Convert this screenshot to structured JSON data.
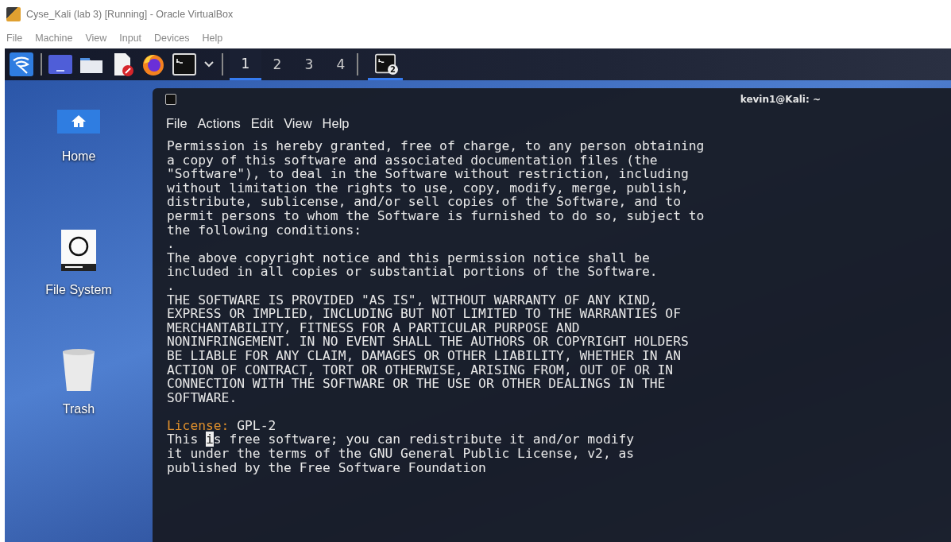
{
  "window": {
    "title": "Cyse_Kali (lab 3) [Running] - Oracle VirtualBox"
  },
  "menu": [
    "File",
    "Machine",
    "View",
    "Input",
    "Devices",
    "Help"
  ],
  "taskbar": {
    "launchers": [
      {
        "kind": "kali"
      },
      {
        "kind": "sep"
      },
      {
        "kind": "panel"
      },
      {
        "kind": "folder"
      },
      {
        "kind": "editor"
      },
      {
        "kind": "firefox"
      },
      {
        "kind": "terminal"
      },
      {
        "kind": "chevron"
      },
      {
        "kind": "sep"
      }
    ],
    "workspaces": [
      {
        "label": "1",
        "selected": true
      },
      {
        "label": "2",
        "selected": false
      },
      {
        "label": "3",
        "selected": false
      },
      {
        "label": "4",
        "selected": false
      }
    ],
    "task": {
      "badge": "2",
      "selected": true
    }
  },
  "desktop_icons": [
    {
      "kind": "home",
      "label": "Home"
    },
    {
      "kind": "drive",
      "label": "File System"
    },
    {
      "kind": "trash",
      "label": "Trash"
    }
  ],
  "terminal": {
    "title": "kevin1@Kali: ~",
    "menu": [
      "File",
      "Actions",
      "Edit",
      "View",
      "Help"
    ],
    "lines": [
      {
        "kind": "text",
        "text": "Permission is hereby granted, free of charge, to any person obtaining"
      },
      {
        "kind": "text",
        "text": "a copy of this software and associated documentation files (the"
      },
      {
        "kind": "text",
        "text": "\"Software\"), to deal in the Software without restriction, including"
      },
      {
        "kind": "text",
        "text": "without limitation the rights to use, copy, modify, merge, publish,"
      },
      {
        "kind": "text",
        "text": "distribute, sublicense, and/or sell copies of the Software, and to"
      },
      {
        "kind": "text",
        "text": "permit persons to whom the Software is furnished to do so, subject to"
      },
      {
        "kind": "text",
        "text": "the following conditions:"
      },
      {
        "kind": "text",
        "text": "."
      },
      {
        "kind": "text",
        "text": "The above copyright notice and this permission notice shall be"
      },
      {
        "kind": "text",
        "text": "included in all copies or substantial portions of the Software."
      },
      {
        "kind": "text",
        "text": "."
      },
      {
        "kind": "text",
        "text": "THE SOFTWARE IS PROVIDED \"AS IS\", WITHOUT WARRANTY OF ANY KIND,"
      },
      {
        "kind": "text",
        "text": "EXPRESS OR IMPLIED, INCLUDING BUT NOT LIMITED TO THE WARRANTIES OF"
      },
      {
        "kind": "text",
        "text": "MERCHANTABILITY, FITNESS FOR A PARTICULAR PURPOSE AND"
      },
      {
        "kind": "text",
        "text": "NONINFRINGEMENT. IN NO EVENT SHALL THE AUTHORS OR COPYRIGHT HOLDERS"
      },
      {
        "kind": "text",
        "text": "BE LIABLE FOR ANY CLAIM, DAMAGES OR OTHER LIABILITY, WHETHER IN AN"
      },
      {
        "kind": "text",
        "text": "ACTION OF CONTRACT, TORT OR OTHERWISE, ARISING FROM, OUT OF OR IN"
      },
      {
        "kind": "text",
        "text": "CONNECTION WITH THE SOFTWARE OR THE USE OR OTHER DEALINGS IN THE"
      },
      {
        "kind": "text",
        "text": "SOFTWARE."
      },
      {
        "kind": "blank"
      },
      {
        "kind": "field",
        "label": "License:",
        "value": " GPL-2"
      },
      {
        "kind": "cursor",
        "parts": [
          "This ",
          "i",
          "s free software; you can redistribute it and/or modify"
        ]
      },
      {
        "kind": "text",
        "text": "it under the terms of the GNU General Public License, v2, as"
      },
      {
        "kind": "text",
        "text": "published by the Free Software Foundation"
      }
    ]
  }
}
